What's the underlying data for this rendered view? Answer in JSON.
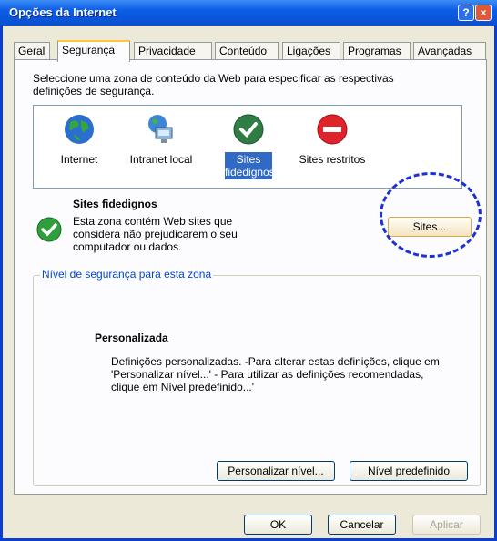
{
  "window": {
    "title": "Opções da Internet",
    "help": "?",
    "close": "×"
  },
  "tabs": [
    "Geral",
    "Segurança",
    "Privacidade",
    "Conteúdo",
    "Ligações",
    "Programas",
    "Avançadas"
  ],
  "instruction": "Seleccione uma zona de conteúdo da Web para especificar as respectivas definições de segurança.",
  "zones": [
    {
      "label": "Internet",
      "icon": "globe-icon"
    },
    {
      "label": "Intranet local",
      "icon": "network-computer-icon"
    },
    {
      "label": "Sites fidedignos",
      "icon": "checkmark-icon"
    },
    {
      "label": "Sites restritos",
      "icon": "restricted-icon"
    }
  ],
  "selected_zone": {
    "title": "Sites fidedignos",
    "description": "Esta zona contém Web sites que considera não prejudicarem o seu computador ou dados."
  },
  "sites_button": "Sites...",
  "security_level": {
    "legend": "Nível de segurança para esta zona",
    "title": "Personalizada",
    "description": "Definições personalizadas. -Para alterar estas definições, clique em 'Personalizar nível...' - Para utilizar as definições recomendadas, clique em Nível predefinido...'",
    "custom_button": "Personalizar nível...",
    "default_button": "Nível predefinido"
  },
  "footer": {
    "ok": "OK",
    "cancel": "Cancelar",
    "apply": "Aplicar"
  },
  "colors": {
    "title_bar": "#0b5ee6",
    "accent_selection": "#316ac5",
    "annotation": "#1d31d6",
    "legend_text": "#0046d5"
  }
}
